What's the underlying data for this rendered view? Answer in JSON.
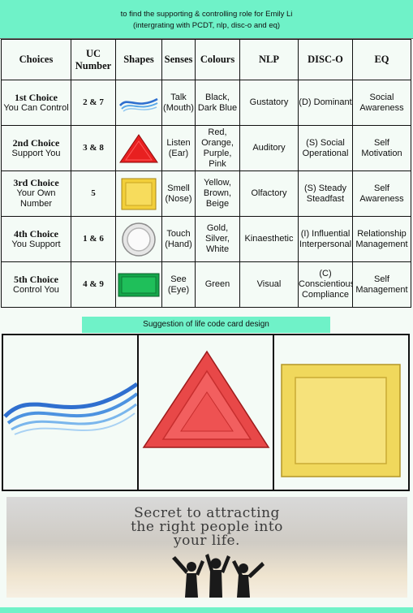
{
  "header": {
    "line1": "to find the supporting & controlling role for  Emily Li",
    "line2": "(intergrating with PCDT, nlp, disc-o and eq)",
    "accent_color": "#6ff2c8"
  },
  "table": {
    "headers": [
      "Choices",
      "UC Number",
      "Shapes",
      "Senses",
      "Colours",
      "NLP",
      "DISC-O",
      "EQ"
    ],
    "rows": [
      {
        "choice_title": "1st Choice",
        "choice_sub": "You Can Control",
        "uc": "2 & 7",
        "shape": "wave-shape",
        "sense": "Talk (Mouth)",
        "colours": "Black, Dark Blue",
        "nlp": "Gustatory",
        "disco": "(D) Dominant",
        "eq": "Social Awareness"
      },
      {
        "choice_title": "2nd Choice",
        "choice_sub": "Support You",
        "uc": "3 & 8",
        "shape": "triangle-shape",
        "sense": "Listen (Ear)",
        "colours": "Red, Orange, Purple, Pink",
        "nlp": "Auditory",
        "disco": "(S) Social Operational",
        "eq": "Self Motivation"
      },
      {
        "choice_title": "3rd Choice",
        "choice_sub": "Your Own Number",
        "uc": "5",
        "shape": "square-shape",
        "sense": "Smell (Nose)",
        "colours": "Yellow, Brown, Beige",
        "nlp": "Olfactory",
        "disco": "(S) Steady Steadfast",
        "eq": "Self Awareness"
      },
      {
        "choice_title": "4th Choice",
        "choice_sub": "You Support",
        "uc": "1 & 6",
        "shape": "circle-shape",
        "sense": "Touch (Hand)",
        "colours": "Gold, Silver, White",
        "nlp": "Kinaesthetic",
        "disco": "(I) Influential Interpersonal",
        "eq": "Relationship Management"
      },
      {
        "choice_title": "5th Choice",
        "choice_sub": "Control You",
        "uc": "4 & 9",
        "shape": "rectangle-shape",
        "sense": "See (Eye)",
        "colours": "Green",
        "nlp": "Visual",
        "disco": "(C) Conscientious Compliance",
        "eq": "Self Management"
      }
    ]
  },
  "suggestion": {
    "label": "Suggestion of life code card design",
    "cards": [
      "wave-shape",
      "triangle-shape",
      "square-shape"
    ]
  },
  "banner": {
    "text_line1": "Secret to attracting",
    "text_line2": "the right people into",
    "text_line3": "your life."
  }
}
